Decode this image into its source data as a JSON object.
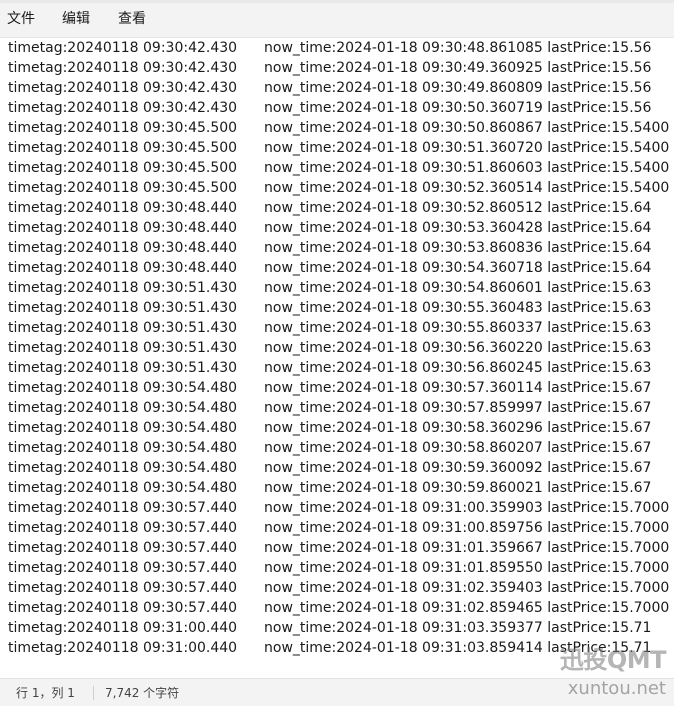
{
  "menu": {
    "file": "文件",
    "edit": "编辑",
    "view": "查看"
  },
  "lines": [
    {
      "timetag": "timetag:20240118 09:30:42.430",
      "rest": "now_time:2024-01-18 09:30:48.861085 lastPrice:15.56"
    },
    {
      "timetag": "timetag:20240118 09:30:42.430",
      "rest": "now_time:2024-01-18 09:30:49.360925 lastPrice:15.56"
    },
    {
      "timetag": "timetag:20240118 09:30:42.430",
      "rest": "now_time:2024-01-18 09:30:49.860809 lastPrice:15.56"
    },
    {
      "timetag": "timetag:20240118 09:30:42.430",
      "rest": "now_time:2024-01-18 09:30:50.360719 lastPrice:15.56"
    },
    {
      "timetag": "timetag:20240118 09:30:45.500",
      "rest": "now_time:2024-01-18 09:30:50.860867 lastPrice:15.5400"
    },
    {
      "timetag": "timetag:20240118 09:30:45.500",
      "rest": "now_time:2024-01-18 09:30:51.360720 lastPrice:15.5400"
    },
    {
      "timetag": "timetag:20240118 09:30:45.500",
      "rest": "now_time:2024-01-18 09:30:51.860603 lastPrice:15.5400"
    },
    {
      "timetag": "timetag:20240118 09:30:45.500",
      "rest": "now_time:2024-01-18 09:30:52.360514 lastPrice:15.5400"
    },
    {
      "timetag": "timetag:20240118 09:30:48.440",
      "rest": "now_time:2024-01-18 09:30:52.860512 lastPrice:15.64"
    },
    {
      "timetag": "timetag:20240118 09:30:48.440",
      "rest": "now_time:2024-01-18 09:30:53.360428 lastPrice:15.64"
    },
    {
      "timetag": "timetag:20240118 09:30:48.440",
      "rest": "now_time:2024-01-18 09:30:53.860836 lastPrice:15.64"
    },
    {
      "timetag": "timetag:20240118 09:30:48.440",
      "rest": "now_time:2024-01-18 09:30:54.360718 lastPrice:15.64"
    },
    {
      "timetag": "timetag:20240118 09:30:51.430",
      "rest": "now_time:2024-01-18 09:30:54.860601 lastPrice:15.63"
    },
    {
      "timetag": "timetag:20240118 09:30:51.430",
      "rest": "now_time:2024-01-18 09:30:55.360483 lastPrice:15.63"
    },
    {
      "timetag": "timetag:20240118 09:30:51.430",
      "rest": "now_time:2024-01-18 09:30:55.860337 lastPrice:15.63"
    },
    {
      "timetag": "timetag:20240118 09:30:51.430",
      "rest": "now_time:2024-01-18 09:30:56.360220 lastPrice:15.63"
    },
    {
      "timetag": "timetag:20240118 09:30:51.430",
      "rest": "now_time:2024-01-18 09:30:56.860245 lastPrice:15.63"
    },
    {
      "timetag": "timetag:20240118 09:30:54.480",
      "rest": "now_time:2024-01-18 09:30:57.360114 lastPrice:15.67"
    },
    {
      "timetag": "timetag:20240118 09:30:54.480",
      "rest": "now_time:2024-01-18 09:30:57.859997 lastPrice:15.67"
    },
    {
      "timetag": "timetag:20240118 09:30:54.480",
      "rest": "now_time:2024-01-18 09:30:58.360296 lastPrice:15.67"
    },
    {
      "timetag": "timetag:20240118 09:30:54.480",
      "rest": "now_time:2024-01-18 09:30:58.860207 lastPrice:15.67"
    },
    {
      "timetag": "timetag:20240118 09:30:54.480",
      "rest": "now_time:2024-01-18 09:30:59.360092 lastPrice:15.67"
    },
    {
      "timetag": "timetag:20240118 09:30:54.480",
      "rest": "now_time:2024-01-18 09:30:59.860021 lastPrice:15.67"
    },
    {
      "timetag": "timetag:20240118 09:30:57.440",
      "rest": "now_time:2024-01-18 09:31:00.359903 lastPrice:15.7000"
    },
    {
      "timetag": "timetag:20240118 09:30:57.440",
      "rest": "now_time:2024-01-18 09:31:00.859756 lastPrice:15.7000"
    },
    {
      "timetag": "timetag:20240118 09:30:57.440",
      "rest": "now_time:2024-01-18 09:31:01.359667 lastPrice:15.7000"
    },
    {
      "timetag": "timetag:20240118 09:30:57.440",
      "rest": "now_time:2024-01-18 09:31:01.859550 lastPrice:15.7000"
    },
    {
      "timetag": "timetag:20240118 09:30:57.440",
      "rest": "now_time:2024-01-18 09:31:02.359403 lastPrice:15.7000"
    },
    {
      "timetag": "timetag:20240118 09:30:57.440",
      "rest": "now_time:2024-01-18 09:31:02.859465 lastPrice:15.7000"
    },
    {
      "timetag": "timetag:20240118 09:31:00.440",
      "rest": "now_time:2024-01-18 09:31:03.359377 lastPrice:15.71"
    },
    {
      "timetag": "timetag:20240118 09:31:00.440",
      "rest": "now_time:2024-01-18 09:31:03.859414 lastPrice:15.71"
    }
  ],
  "status": {
    "position": "行 1，列 1",
    "char_count": "7,742 个字符"
  },
  "watermark": {
    "brand": "迅投QMT",
    "site": "xuntou.net"
  },
  "colors": {
    "text": "#1a1a1a",
    "menubar_bg": "#f3f3f3",
    "editor_bg": "#ffffff",
    "statusbar_bg": "#f3f3f3"
  }
}
